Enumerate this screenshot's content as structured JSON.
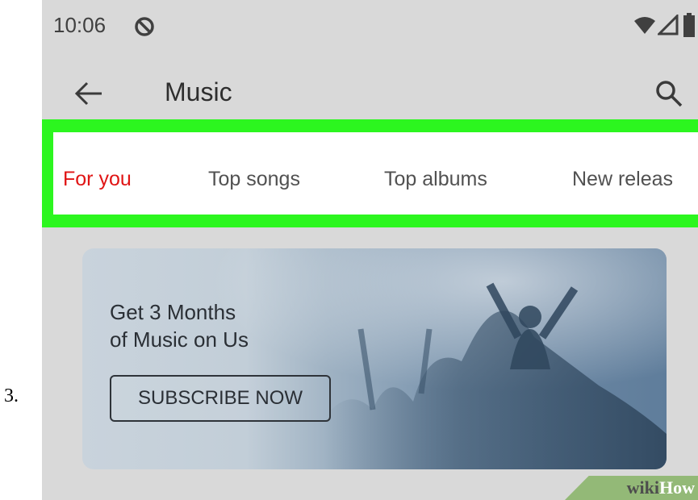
{
  "step_number": "3.",
  "status_bar": {
    "time": "10:06",
    "icons": [
      "do-not-disturb-icon",
      "wifi-icon",
      "cellular-signal-icon",
      "battery-icon"
    ]
  },
  "app_bar": {
    "title": "Music",
    "icons": [
      "back-arrow-icon",
      "search-icon"
    ]
  },
  "tabs": [
    {
      "label": "For you",
      "active": true
    },
    {
      "label": "Top songs",
      "active": false
    },
    {
      "label": "Top albums",
      "active": false
    },
    {
      "label": "New releas",
      "active": false
    }
  ],
  "banner": {
    "headline_line1": "Get 3 Months",
    "headline_line2": "of Music on Us",
    "button_label": "SUBSCRIBE NOW"
  },
  "watermark": {
    "wiki": "wiki",
    "how": "How"
  },
  "colors": {
    "active_tab": "#e01414",
    "highlight_outline": "#2cf61f",
    "screen_background": "#d9d9d9",
    "watermark_green": "#93b977"
  }
}
